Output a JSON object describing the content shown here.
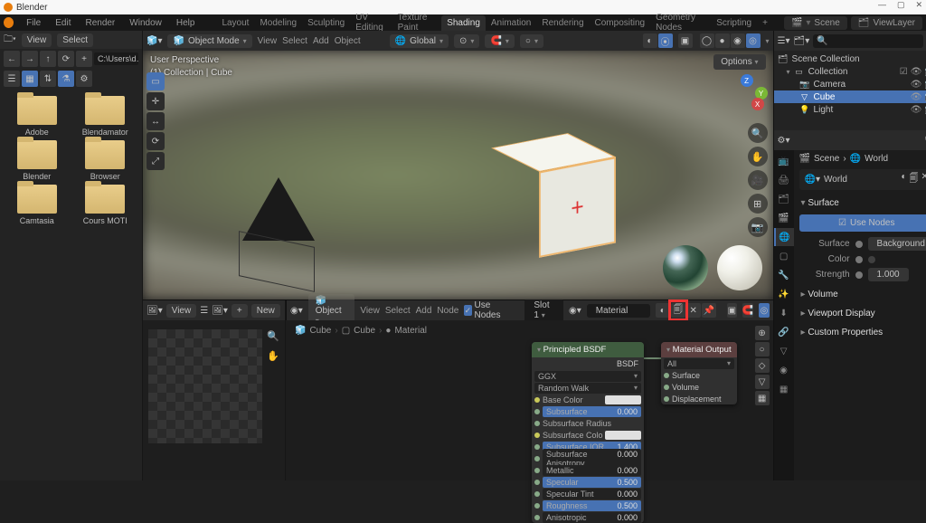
{
  "app": {
    "title": "Blender"
  },
  "win_controls": {
    "min": "—",
    "max": "▢",
    "close": "✕"
  },
  "top_menu": [
    "File",
    "Edit",
    "Render",
    "Window",
    "Help"
  ],
  "workspaces": [
    "Layout",
    "Modeling",
    "Sculpting",
    "UV Editing",
    "Texture Paint",
    "Shading",
    "Animation",
    "Rendering",
    "Compositing",
    "Geometry Nodes",
    "Scripting"
  ],
  "workspace_active": "Shading",
  "scene": {
    "scene_label": "Scene",
    "layer_label": "ViewLayer"
  },
  "filebrowser": {
    "menu": {
      "view": "View",
      "select": "Select"
    },
    "nav": {
      "back": "←",
      "fwd": "→",
      "up": "↑",
      "refresh": "⟳",
      "new": "+"
    },
    "path": "C:\\Users\\d…",
    "toolbar_icons": [
      "list",
      "thumb",
      "sort",
      "filter",
      "gear"
    ],
    "new_btn": "New",
    "folders": [
      "Adobe",
      "Blendamator",
      "Blender",
      "Browser",
      "Camtasia",
      "Cours MOTI"
    ]
  },
  "viewport": {
    "mode": "Object Mode",
    "menus": [
      "View",
      "Select",
      "Add",
      "Object"
    ],
    "orientation": "Global",
    "overlay_line1": "User Perspective",
    "overlay_line2": "(1) Collection | Cube",
    "options": "Options",
    "gizmo_icons": [
      "🔍",
      "✋",
      "🎥",
      "⊞",
      "📷"
    ],
    "axes": {
      "x": "X",
      "y": "Y",
      "z": "Z"
    }
  },
  "preview": {
    "menu": "View",
    "plus": "+",
    "new": "New"
  },
  "node_editor": {
    "mode": "Object",
    "menus": [
      "View",
      "Select",
      "Add",
      "Node"
    ],
    "use_nodes_check": "Use Nodes",
    "slot": "Slot 1",
    "material": "Material",
    "breadcrumb": [
      "Cube",
      "Cube",
      "Material"
    ],
    "nodes": {
      "bsdf": {
        "title": "Principled BSDF",
        "out": "BSDF",
        "rows": [
          {
            "label": "GGX",
            "type": "enum"
          },
          {
            "label": "Random Walk",
            "type": "enum"
          },
          {
            "label": "Base Color",
            "type": "color"
          },
          {
            "label": "Subsurface",
            "val": "0.000",
            "sel": true
          },
          {
            "label": "Subsurface Radius",
            "type": "vec"
          },
          {
            "label": "Subsurface Colo",
            "type": "color"
          },
          {
            "label": "Subsurface IOR",
            "val": "1.400",
            "sel": true
          },
          {
            "label": "Subsurface Anisotropy",
            "val": "0.000"
          },
          {
            "label": "Metallic",
            "val": "0.000"
          },
          {
            "label": "Specular",
            "val": "0.500",
            "sel": true
          },
          {
            "label": "Specular Tint",
            "val": "0.000"
          },
          {
            "label": "Roughness",
            "val": "0.500",
            "sel": true
          },
          {
            "label": "Anisotropic",
            "val": "0.000"
          }
        ]
      },
      "output": {
        "title": "Material Output",
        "target": "All",
        "ins": [
          "Surface",
          "Volume",
          "Displacement"
        ]
      }
    }
  },
  "outliner": {
    "search_placeholder": "",
    "collection_root": "Scene Collection",
    "collection": "Collection",
    "items": [
      "Camera",
      "Cube",
      "Light"
    ],
    "active_item": "Cube"
  },
  "properties": {
    "breadcrumb": [
      "Scene",
      "World"
    ],
    "world": "World",
    "panel_surface": "Surface",
    "use_nodes": "Use Nodes",
    "surface_label": "Surface",
    "surface_value": "Background",
    "color_label": "Color",
    "strength_label": "Strength",
    "strength_value": "1.000",
    "panel_volume": "Volume",
    "panel_vpdisplay": "Viewport Display",
    "panel_custom": "Custom Properties"
  }
}
